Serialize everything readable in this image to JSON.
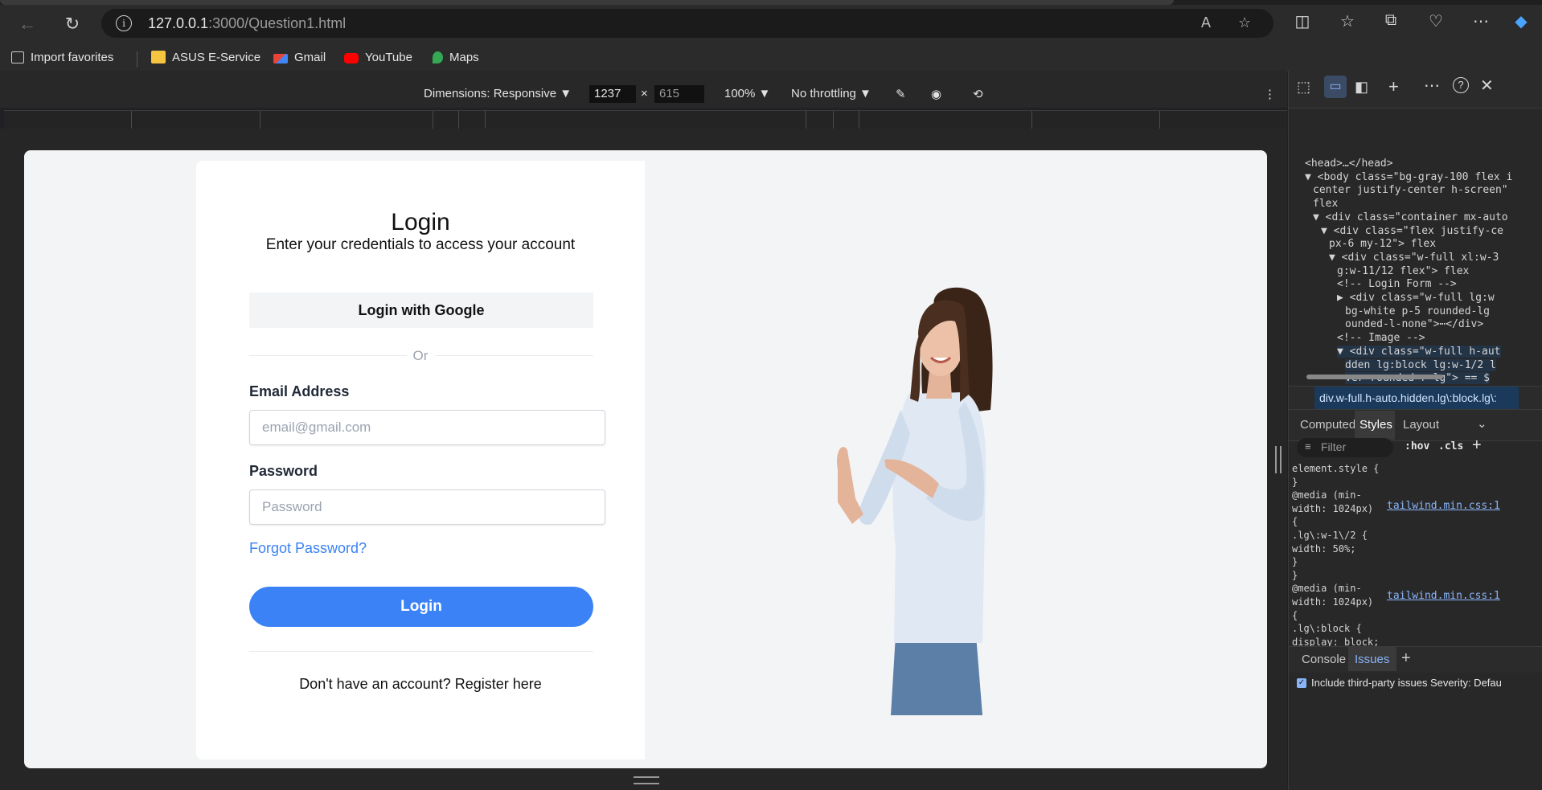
{
  "browser": {
    "url_host": "127.0.0.1",
    "url_path": ":3000/Question1.html",
    "favorites": [
      "Import favorites",
      "ASUS E-Service",
      "Gmail",
      "YouTube",
      "Maps"
    ]
  },
  "device_toolbar": {
    "dimensions_label": "Dimensions: Responsive",
    "width": "1237",
    "height": "615",
    "zoom": "100%",
    "throttling": "No throttling"
  },
  "login_page": {
    "title": "Login",
    "subtitle": "Enter your credentials to access your account",
    "google_button": "Login with Google",
    "divider_text": "Or",
    "email_label": "Email Address",
    "email_placeholder": "email@gmail.com",
    "password_label": "Password",
    "password_placeholder": "Password",
    "forgot_link": "Forgot Password?",
    "login_button": "Login",
    "register_text": "Don't have an account? Register here"
  },
  "devtools": {
    "html_lines": [
      {
        "indent": 0,
        "html": "&lt;head&gt;…&lt;/head&gt;"
      },
      {
        "indent": 0,
        "html": "▼ &lt;body class=\"bg-gray-100 flex i"
      },
      {
        "indent": 1,
        "html": "center justify-center h-screen\""
      },
      {
        "indent": 1,
        "html": "flex"
      },
      {
        "indent": 1,
        "html": "▼ &lt;div class=\"container mx-auto"
      },
      {
        "indent": 2,
        "html": "▼ &lt;div class=\"flex justify-ce"
      },
      {
        "indent": 3,
        "html": "px-6 my-12\"&gt; flex"
      },
      {
        "indent": 3,
        "html": "▼ &lt;div class=\"w-full xl:w-3"
      },
      {
        "indent": 4,
        "html": "g:w-11/12 flex\"&gt; flex"
      },
      {
        "indent": 4,
        "html": "&lt;!-- Login Form --&gt;"
      },
      {
        "indent": 4,
        "html": "▶ &lt;div class=\"w-full lg:w"
      },
      {
        "indent": 5,
        "html": "bg-white p-5 rounded-lg"
      },
      {
        "indent": 5,
        "html": "ounded-l-none\"&gt;⋯&lt;/div&gt;"
      },
      {
        "indent": 4,
        "html": "&lt;!-- Image --&gt;"
      },
      {
        "indent": 4,
        "html": "▼ &lt;div class=\"w-full h-aut"
      },
      {
        "indent": 5,
        "html": "dden lg:block lg:w-1/2 l"
      },
      {
        "indent": 5,
        "html": "ver rounded-r-lg\"&gt; == $"
      }
    ],
    "breadcrumb": "div.w-full.h-auto.hidden.lg\\:block.lg\\:",
    "tabs": [
      "Computed",
      "Styles",
      "Layout"
    ],
    "active_tab": "Styles",
    "filter_placeholder": "Filter",
    "hov": ":hov",
    "cls": ".cls",
    "styles": [
      "element.style {",
      "}",
      "@media (min-",
      "width: 1024px)",
      "{",
      " .lg\\:w-1\\/2 {",
      "   width: 50%;",
      " }",
      "}",
      "@media (min-",
      "width: 1024px)",
      "{",
      " .lg\\:block {",
      "   display: block;"
    ],
    "stylesheet_link": "tailwind.min.css:1",
    "drawer_tabs": [
      "Console",
      "Issues"
    ],
    "active_drawer_tab": "Issues",
    "third_party_label": "Include third-party issues",
    "severity_label": "Severity: Defau"
  },
  "colors": {
    "primary": "#3b82f6",
    "page_bg": "#f3f4f6",
    "chrome_bg": "#2b2b2b"
  }
}
